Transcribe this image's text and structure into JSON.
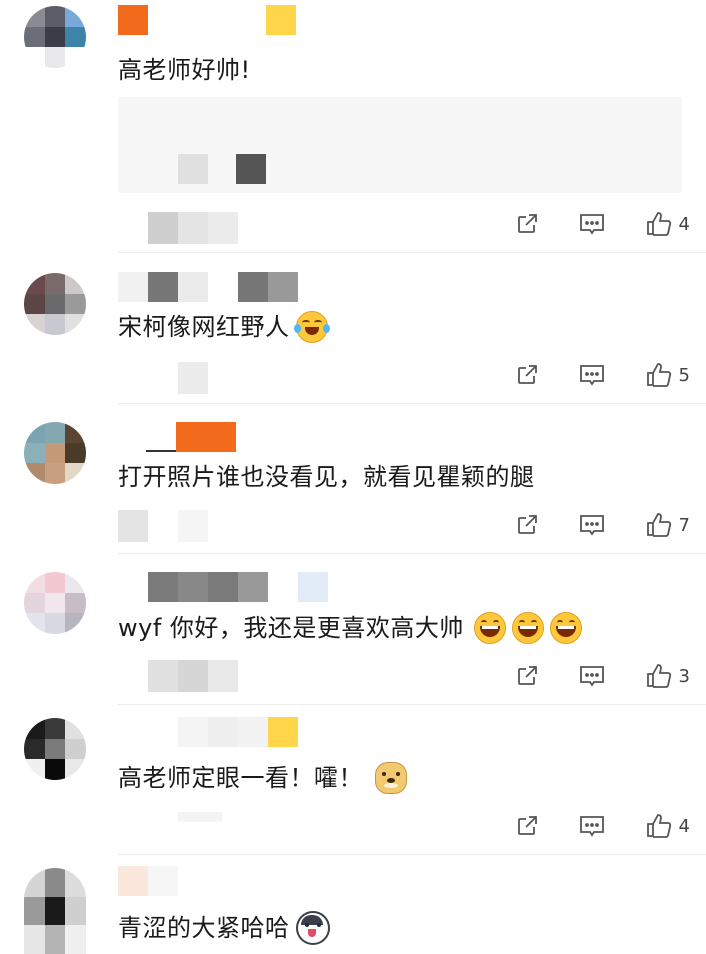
{
  "comments": [
    {
      "text": "高老师好帅!",
      "emoji": "",
      "likes": "4"
    },
    {
      "text": "宋柯像网红野人",
      "emoji": "laughing-crying",
      "likes": "5"
    },
    {
      "text": "打开照片谁也没看见，就看见瞿颖的腿",
      "emoji": "",
      "likes": "7"
    },
    {
      "text": "wyf 你好，我还是更喜欢高大帅",
      "emoji": "grin-x3",
      "likes": "3"
    },
    {
      "text": "高老师定眼一看！嚯！",
      "emoji": "doge",
      "likes": "4"
    },
    {
      "text": "青涩的大紧哈哈",
      "emoji": "husky",
      "likes": ""
    }
  ],
  "icons": {
    "share": "share-icon",
    "comment": "comment-icon",
    "like": "thumbs-up-icon"
  },
  "colors": {
    "accent_orange": "#f26b1d",
    "accent_yellow": "#ffd54a",
    "text": "#1a1a1a",
    "icon": "#444444"
  }
}
